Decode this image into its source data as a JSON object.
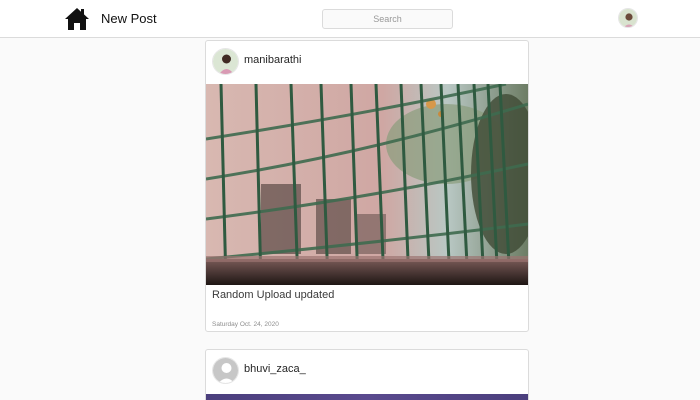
{
  "header": {
    "new_post_label": "New Post",
    "search_placeholder": "Search"
  },
  "posts": [
    {
      "username": "manibarathi",
      "caption": "Random Upload updated",
      "timestamp": "Saturday Oct. 24, 2020"
    },
    {
      "username": "bhuvi_zaca_"
    }
  ],
  "icons": {
    "home": "home-icon",
    "profile": "avatar"
  },
  "colors": {
    "background": "#fafafa",
    "card": "#ffffff",
    "border": "#dbdbdb",
    "muted_text": "#8e8e8e"
  }
}
